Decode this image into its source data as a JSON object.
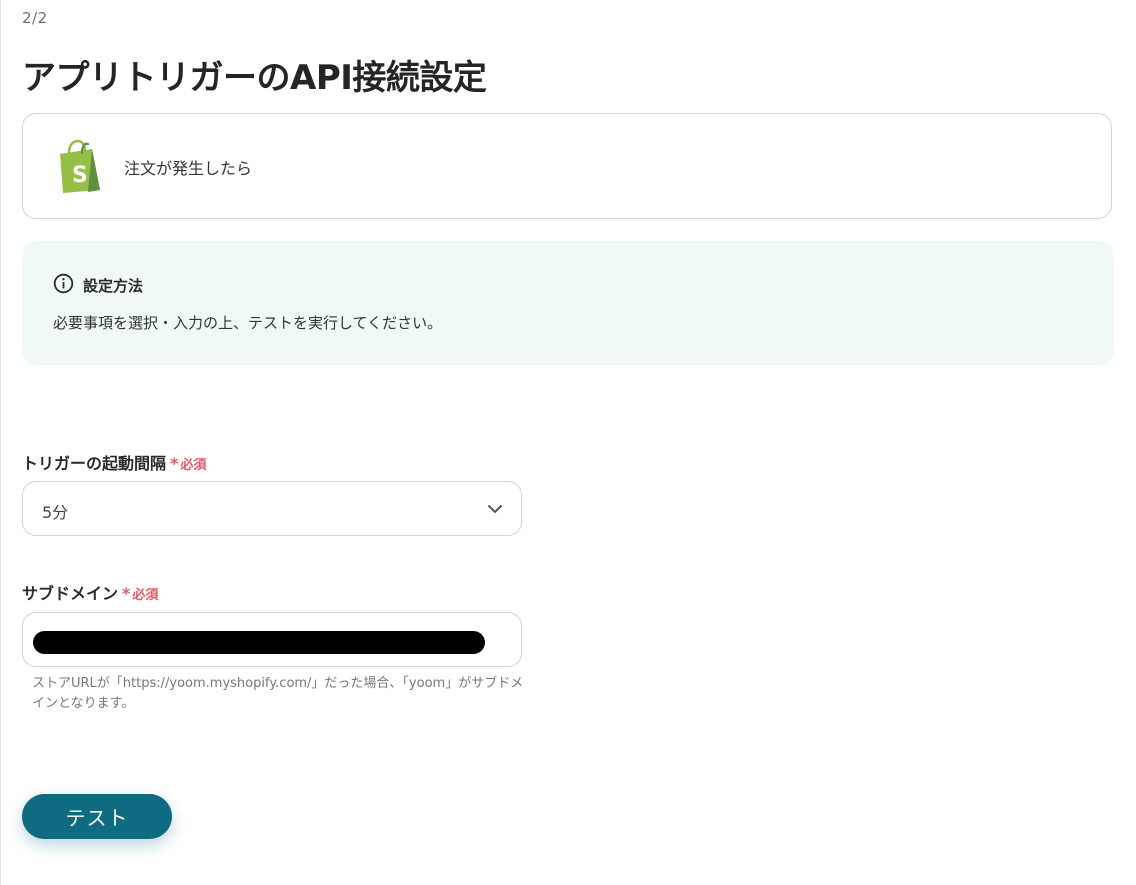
{
  "page": {
    "step": "2/2",
    "title": "アプリトリガーのAPI接続設定"
  },
  "trigger": {
    "app_icon": "shopify-bag-icon",
    "label": "注文が発生したら"
  },
  "info": {
    "icon": "info-icon",
    "title": "設定方法",
    "body": "必要事項を選択・入力の上、テストを実行してください。"
  },
  "fields": {
    "interval": {
      "label": "トリガーの起動間隔",
      "required_star": "*",
      "required_text": "必須",
      "value": "5分"
    },
    "subdomain": {
      "label": "サブドメイン",
      "required_star": "*",
      "required_text": "必須",
      "value": "",
      "helper": "ストアURLが「https://yoom.myshopify.com/」だった場合、「yoom」がサブドメインとなります。"
    }
  },
  "actions": {
    "test_label": "テスト"
  },
  "colors": {
    "accent": "#0f6b82",
    "required": "#e35a64",
    "info_bg": "#f1f8f8",
    "shopify_green": "#95bf47"
  }
}
